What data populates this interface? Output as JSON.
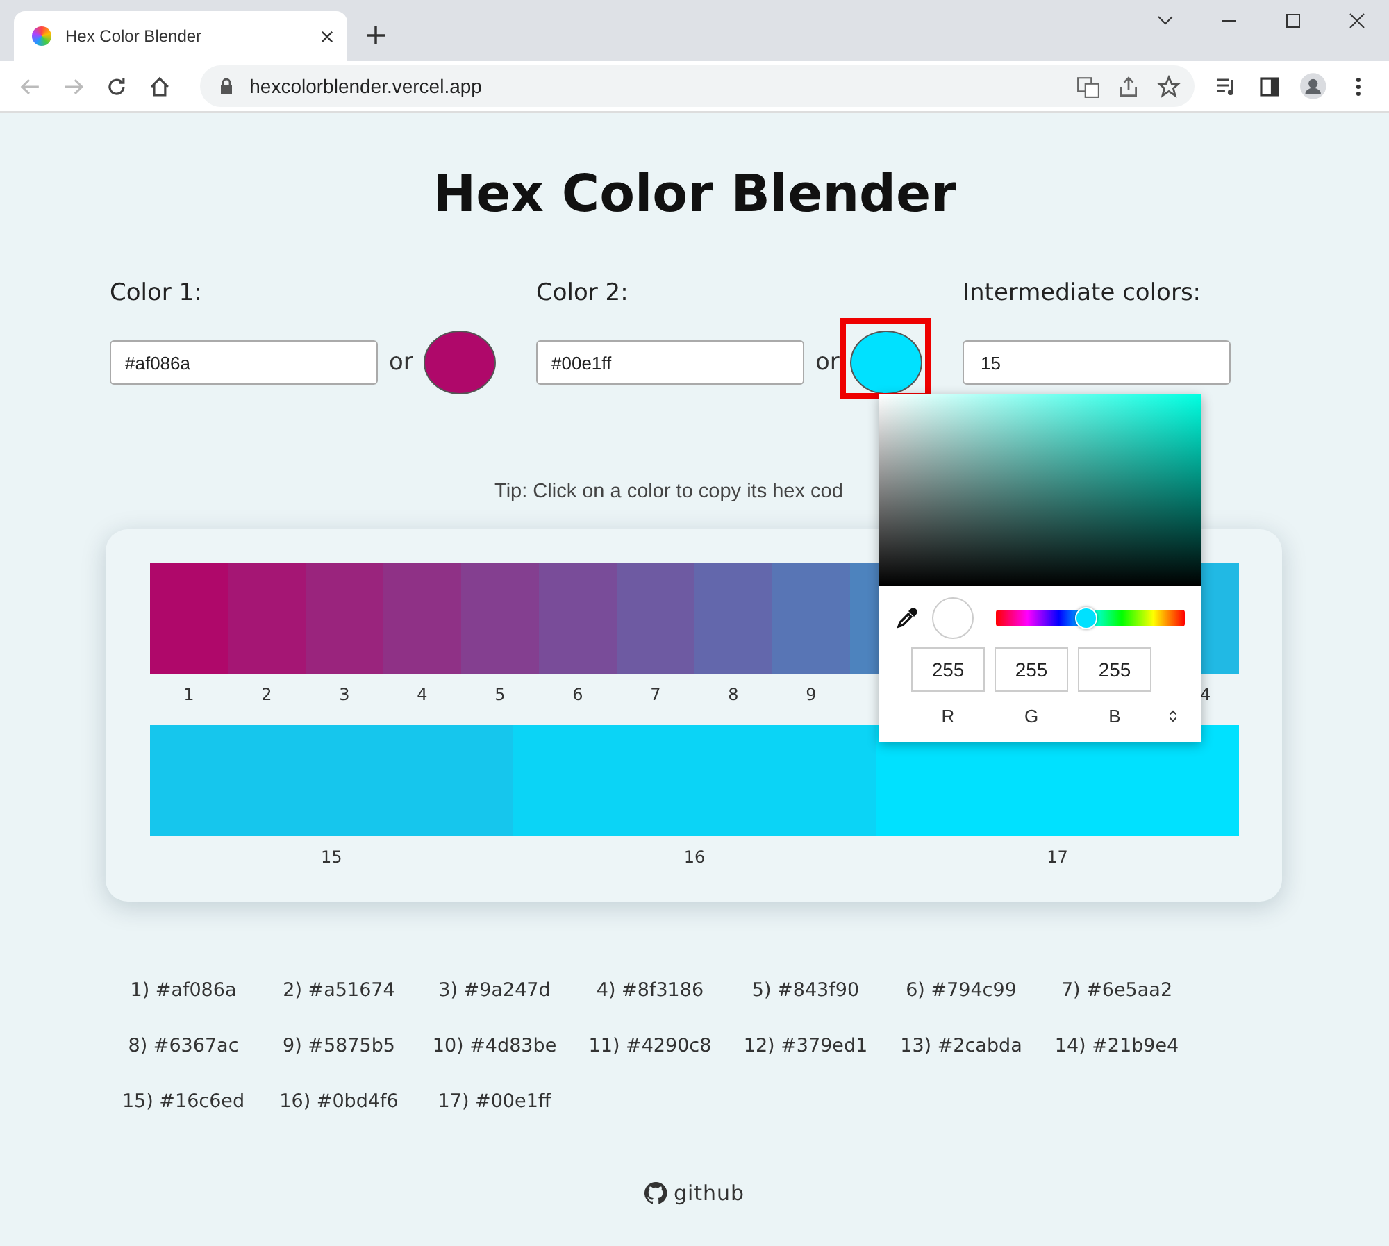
{
  "browser": {
    "tab_title": "Hex Color Blender",
    "url": "hexcolorblender.vercel.app"
  },
  "title": "Hex Color Blender",
  "colors": [
    {
      "label": "Color 1:",
      "value": "#af086a",
      "or": "or",
      "highlighted": false
    },
    {
      "label": "Color 2:",
      "value": "#00e1ff",
      "or": "or",
      "highlighted": true
    }
  ],
  "intermediate": {
    "label": "Intermediate colors:",
    "value": "15"
  },
  "tip": "Tip: Click on a color to copy its hex cod",
  "swatch_rows": [
    [
      {
        "label": "1",
        "color": "#af086a"
      },
      {
        "label": "2",
        "color": "#a51674"
      },
      {
        "label": "3",
        "color": "#9a247d"
      },
      {
        "label": "4",
        "color": "#8f3186"
      },
      {
        "label": "5",
        "color": "#843f90"
      },
      {
        "label": "6",
        "color": "#794c99"
      },
      {
        "label": "7",
        "color": "#6e5aa2"
      },
      {
        "label": "8",
        "color": "#6367ac"
      },
      {
        "label": "9",
        "color": "#5875b5"
      },
      {
        "color": "#4d83be"
      },
      {
        "label": "4",
        "color": "#21b9e4"
      }
    ],
    [
      {
        "label": "15",
        "color": "#16c6ed"
      },
      {
        "label": "16",
        "color": "#0bd4f6"
      },
      {
        "label": "17",
        "color": "#00e1ff"
      }
    ]
  ],
  "hex_list": [
    "1) #af086a",
    "2) #a51674",
    "3) #9a247d",
    "4) #8f3186",
    "5) #843f90",
    "6) #794c99",
    "7) #6e5aa2",
    "8) #6367ac",
    "9) #5875b5",
    "10) #4d83be",
    "11) #4290c8",
    "12) #379ed1",
    "13) #2cabda",
    "14) #21b9e4",
    "15) #16c6ed",
    "16) #0bd4f6",
    "17) #00e1ff"
  ],
  "footer_link": "github",
  "picker": {
    "hue": {
      "level": 0.48
    },
    "channels": [
      {
        "value": "255",
        "label": "R"
      },
      {
        "value": "255",
        "label": "G"
      },
      {
        "value": "255",
        "label": "B"
      }
    ]
  }
}
